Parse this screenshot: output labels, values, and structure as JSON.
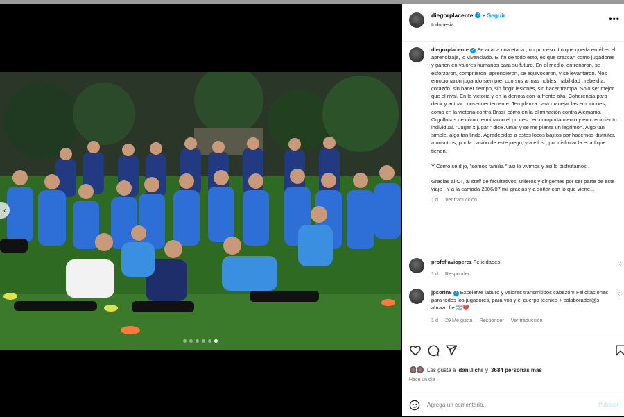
{
  "post": {
    "author": "diegorplacente",
    "follow_label": "Seguir",
    "separator": "•",
    "location": "Indonesia",
    "more_label": "•••"
  },
  "caption": {
    "author": "diegorplacente",
    "paragraph1": "Se acaba una etapa , un proceso. Lo que queda en él es el aprendizaje, lo vivenciado. El fin de todo esto, es que crezcan como jugadores y ganen en valores humanos para su futuro. En el medio, entrenaron, se esforzaron, compitieron, aprendieron, se equivocaron, y se levantaron. Nos emocionaron jugando siempre, con sus armas nobles, habilidad , rebeldía, corazón, sin hacer tiempo, sin fingir lesiones, sin hacer trampa. Solo ser mejor que el rival. En la victoria y en la derrota con la frente alta. Coherencia para decir y actuar consecuentemente. Templanza para manejar las emociones, como en la victoria contra Brasil cómo en la eliminación contra Alemania. Orgullosos de cómo terminaron el proceso en comportamiento y en crecimiento individual. \"Jugar x jugar \" dice Aimar y se me pianta un lagrimon. Algo tan simple, algo tan lindo. Agradecidos a estos locos bajitos por hacernos disfrutar, a nosotros, por la pasión de este juego, y a ellos , por disfrutar la edad que tienen.",
    "paragraph2": "Y Como se dijo, \"somos familia \" asi lo vivimos y asi lo disfrutamos .",
    "paragraph3": "Gracias al CT, al staff de facultativos, utileros y dirigentes por ser parte de este viaje . Y a la camada 2006/07 mil gracias y a soñar con lo que viene...",
    "time": "1 d",
    "translate_label": "Ver traducción"
  },
  "comments": [
    {
      "author": "profeflavioperez",
      "text": "Felicidades",
      "time": "1 d",
      "reply_label": "Responder"
    },
    {
      "author": "jpsorin6",
      "text": "Excelente laburo y valores transmitidos cabezón! Felicitaciones para todos los jugadores, para vos y el cuerpo técnico + colaborador@s abrazo fte 🇦🇷❤️",
      "time": "1 d",
      "likes": "29 Me gusta",
      "reply_label": "Responder",
      "translate_label": "Ver traducción"
    }
  ],
  "likes": {
    "prefix": "Les gusta a",
    "first_user": "dani.lichi",
    "conjunction": "y",
    "others": "3684 personas más"
  },
  "posted_ago": "Hace un día",
  "add_comment": {
    "placeholder": "Agrega un comentario...",
    "post_label": "Publicar"
  },
  "carousel": {
    "dots": 6,
    "active": 5
  },
  "colors": {
    "accent": "#0095f6",
    "grass": "#2f6a22",
    "jersey": "#2d6fd6"
  },
  "icons": [
    "heart-icon",
    "comment-icon",
    "share-icon",
    "save-icon",
    "emoji-icon",
    "verified-icon",
    "more-icon"
  ]
}
